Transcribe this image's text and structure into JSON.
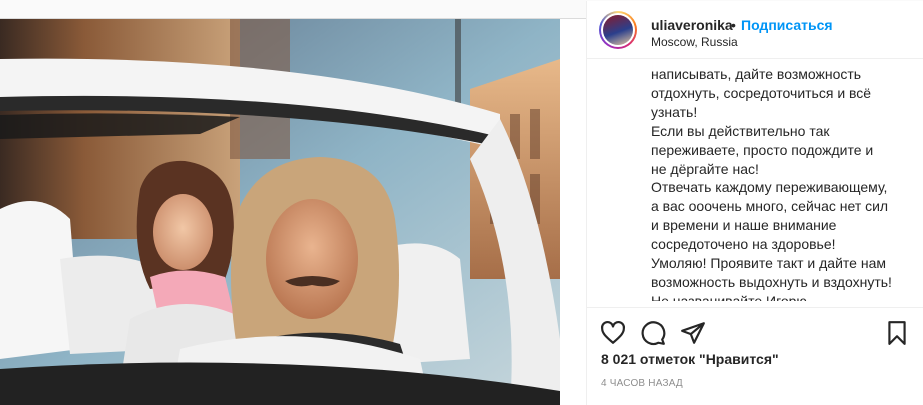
{
  "post": {
    "username": "uliaveronika",
    "dot": "•",
    "follow_label": "Подписаться",
    "location": "Moscow, Russia",
    "caption": "написывать, дайте возможность\nотдохнуть, сосредоточиться и всё\nузнать!\nЕсли вы действительно так\nпереживаете, просто подождите и\nне дёргайте нас!\nОтвечать каждому переживающему,\nа вас ооочень много, сейчас нет сил\nи времени и наше внимание\nсосредоточено на здоровье!\nУмоляю! Проявите такт и дайте нам\nвозможность выдохнуть и вздохнуть!\nНе названивайте Игорю,",
    "likes": "8 021 отметок \"Нравится\"",
    "time": "4 часов назад"
  },
  "icons": {
    "like": "heart-outline-icon",
    "comment": "speech-bubble-icon",
    "share": "paper-plane-icon",
    "save": "bookmark-icon"
  },
  "colors": {
    "follow": "#0095f6",
    "text": "#262626",
    "muted": "#8e8e8e"
  }
}
